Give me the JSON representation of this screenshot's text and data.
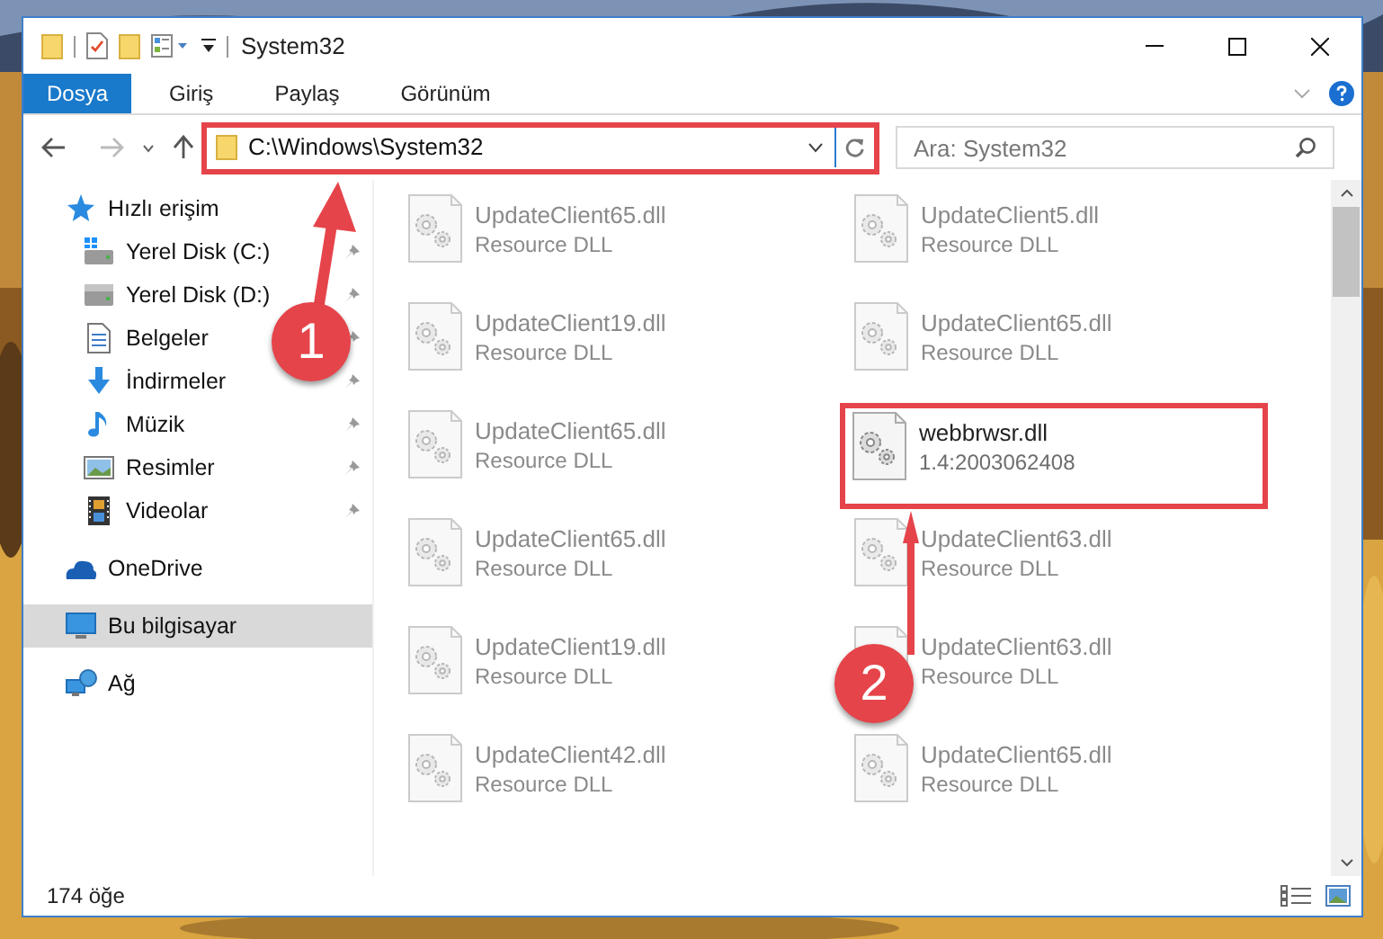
{
  "window": {
    "title": "System32"
  },
  "ribbon_tabs": [
    {
      "label": "Dosya",
      "selected": true
    },
    {
      "label": "Giriş",
      "selected": false
    },
    {
      "label": "Paylaş",
      "selected": false
    },
    {
      "label": "Görünüm",
      "selected": false
    }
  ],
  "address_bar": {
    "path": "C:\\Windows\\System32",
    "highlighted": true
  },
  "search": {
    "placeholder": "Ara: System32"
  },
  "sidebar": {
    "items": [
      {
        "label": "Hızlı erişim",
        "selected": false,
        "children": [
          {
            "label": "Yerel Disk (C:)",
            "pinned": true
          },
          {
            "label": "Yerel Disk (D:)",
            "pinned": true
          },
          {
            "label": "Belgeler",
            "pinned": true
          },
          {
            "label": "İndirmeler",
            "pinned": true
          },
          {
            "label": "Müzik",
            "pinned": true
          },
          {
            "label": "Resimler",
            "pinned": true
          },
          {
            "label": "Videolar",
            "pinned": true
          }
        ]
      },
      {
        "label": "OneDrive",
        "selected": false
      },
      {
        "label": "Bu bilgisayar",
        "selected": true
      },
      {
        "label": "Ağ",
        "selected": false
      }
    ]
  },
  "files": [
    {
      "name": "UpdateClient65.dll",
      "description": "Resource DLL",
      "blurred": true,
      "highlighted": false
    },
    {
      "name": "UpdateClient5.dll",
      "description": "Resource DLL",
      "blurred": true,
      "highlighted": false
    },
    {
      "name": "UpdateClient19.dll",
      "description": "Resource DLL",
      "blurred": true,
      "highlighted": false
    },
    {
      "name": "UpdateClient65.dll",
      "description": "Resource DLL",
      "blurred": true,
      "highlighted": false
    },
    {
      "name": "UpdateClient65.dll",
      "description": "Resource DLL",
      "blurred": true,
      "highlighted": false
    },
    {
      "name": "webbrwsr.dll",
      "description": "1.4:2003062408",
      "blurred": false,
      "highlighted": true
    },
    {
      "name": "UpdateClient65.dll",
      "description": "Resource DLL",
      "blurred": true,
      "highlighted": false
    },
    {
      "name": "UpdateClient63.dll",
      "description": "Resource DLL",
      "blurred": true,
      "highlighted": false
    },
    {
      "name": "UpdateClient19.dll",
      "description": "Resource DLL",
      "blurred": true,
      "highlighted": false
    },
    {
      "name": "UpdateClient63.dll",
      "description": "Resource DLL",
      "blurred": true,
      "highlighted": false
    },
    {
      "name": "UpdateClient42.dll",
      "description": "Resource DLL",
      "blurred": true,
      "highlighted": false
    },
    {
      "name": "UpdateClient65.dll",
      "description": "Resource DLL",
      "blurred": true,
      "highlighted": false
    }
  ],
  "status_bar": {
    "item_count": "174 öğe"
  },
  "annotations": [
    {
      "label": "1"
    },
    {
      "label": "2"
    }
  ]
}
